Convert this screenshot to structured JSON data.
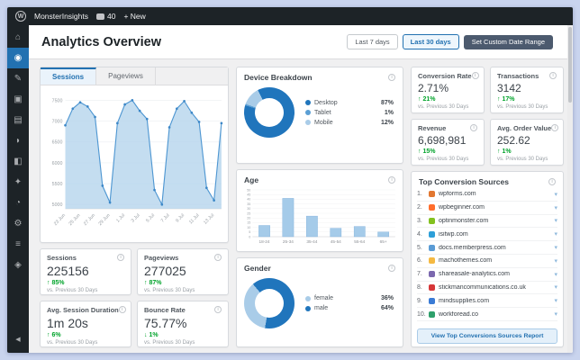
{
  "icons": {
    "wp_logo": "W",
    "info": "i",
    "chevron_down": "▾"
  },
  "palette": {
    "accent_blue": "#2271b1",
    "chart_line": "#4f97d2",
    "chart_fill": "#b5d4ec",
    "green": "#00a32a"
  },
  "admin_bar": {
    "site_name": "MonsterInsights",
    "comments_count": "40",
    "new_label": "+ New"
  },
  "sidebar": {
    "items": [
      {
        "name": "dashboard",
        "glyph": "⌂"
      },
      {
        "name": "monsterinsights",
        "glyph": "◉",
        "active": true
      },
      {
        "name": "posts",
        "glyph": "✎"
      },
      {
        "name": "media",
        "glyph": "▣"
      },
      {
        "name": "pages",
        "glyph": "▤"
      },
      {
        "name": "comments",
        "glyph": "◗"
      },
      {
        "name": "appearance",
        "glyph": "◧"
      },
      {
        "name": "plugins",
        "glyph": "✦"
      },
      {
        "name": "users",
        "glyph": "◔"
      },
      {
        "name": "tools",
        "glyph": "⚙"
      },
      {
        "name": "settings",
        "glyph": "≡"
      },
      {
        "name": "analytics",
        "glyph": "◈"
      },
      {
        "name": "collapse",
        "glyph": "◀"
      }
    ]
  },
  "header": {
    "title": "Analytics Overview",
    "last7_label": "Last 7 days",
    "last30_label": "Last 30 days",
    "custom_label": "Set Custom Date Range"
  },
  "chart_data": [
    {
      "name": "sessions_over_time",
      "type": "area",
      "tabs": [
        "Sessions",
        "Pageviews"
      ],
      "active_tab": "Sessions",
      "x": [
        "23 Jun",
        "24 Jun",
        "25 Jun",
        "26 Jun",
        "27 Jun",
        "28 Jun",
        "29 Jun",
        "30 Jun",
        "1 Jul",
        "2 Jul",
        "3 Jul",
        "4 Jul",
        "5 Jul",
        "6 Jul",
        "7 Jul",
        "8 Jul",
        "9 Jul",
        "10 Jul",
        "11 Jul",
        "12 Jul",
        "13 Jul",
        "14 Jul"
      ],
      "values": [
        6900,
        7300,
        7450,
        7350,
        7100,
        5450,
        5050,
        6950,
        7400,
        7500,
        7250,
        7050,
        5350,
        5000,
        6850,
        7300,
        7480,
        7200,
        6980,
        5400,
        5100,
        6950
      ],
      "y_ticks": [
        7500,
        7000,
        6500,
        6000,
        5500,
        5000
      ],
      "ylim": [
        4900,
        7650
      ],
      "grid": true,
      "legend_position": "none"
    },
    {
      "name": "device_breakdown",
      "type": "pie",
      "title": "Device Breakdown",
      "slices": [
        {
          "label": "Desktop",
          "value": 87,
          "color": "#2075bc"
        },
        {
          "label": "Tablet",
          "value": 1,
          "color": "#5b9fd4"
        },
        {
          "label": "Mobile",
          "value": 12,
          "color": "#a9cce8"
        }
      ],
      "rotation": 333,
      "legend_position": "right"
    },
    {
      "name": "age",
      "type": "bar",
      "title": "Age",
      "categories": [
        "18-24",
        "25-34",
        "35-44",
        "45-54",
        "55-64",
        "65+"
      ],
      "values": [
        12,
        41,
        22,
        9,
        11,
        5
      ],
      "y_ticks": [
        50,
        45,
        40,
        35,
        30,
        25,
        20,
        15,
        10,
        5,
        0
      ],
      "ylim": [
        0,
        50
      ],
      "bar_color": "#a5cbe9",
      "grid": true
    },
    {
      "name": "gender",
      "type": "pie",
      "title": "Gender",
      "slices": [
        {
          "label": "female",
          "value": 36,
          "color": "#a9cce8"
        },
        {
          "label": "male",
          "value": 64,
          "color": "#2075bc"
        }
      ],
      "rotation": 190,
      "legend_position": "right"
    }
  ],
  "metrics": {
    "vs_label": "vs. Previous 30 Days",
    "sessions": {
      "label": "Sessions",
      "value": "225156",
      "arrow": "↑",
      "change": "85%"
    },
    "pageviews": {
      "label": "Pageviews",
      "value": "277025",
      "arrow": "↑",
      "change": "87%"
    },
    "avg_session_duration": {
      "label": "Avg. Session Duration",
      "value": "1m 20s",
      "arrow": "↑",
      "change": "6%"
    },
    "bounce_rate": {
      "label": "Bounce Rate",
      "value": "75.77%",
      "arrow": "↓",
      "change": "1%"
    },
    "conversion_rate": {
      "label": "Conversion Rate",
      "value": "2.71%",
      "arrow": "↑",
      "change": "21%"
    },
    "transactions": {
      "label": "Transactions",
      "value": "3142",
      "arrow": "↑",
      "change": "17%"
    },
    "revenue": {
      "label": "Revenue",
      "value": "6,698,981",
      "arrow": "↑",
      "change": "15%"
    },
    "avg_order_value": {
      "label": "Avg. Order Value",
      "value": "252.62",
      "arrow": "↑",
      "change": "1%"
    }
  },
  "top_sources": {
    "title": "Top Conversion Sources",
    "items": [
      {
        "rank": "1.",
        "domain": "wpforms.com",
        "favicon_color": "#e27730"
      },
      {
        "rank": "2.",
        "domain": "wpbeginner.com",
        "favicon_color": "#ff6d2c"
      },
      {
        "rank": "3.",
        "domain": "optinmonster.com",
        "favicon_color": "#83c11f"
      },
      {
        "rank": "4.",
        "domain": "isitwp.com",
        "favicon_color": "#2d9fd8"
      },
      {
        "rank": "5.",
        "domain": "docs.memberpress.com",
        "favicon_color": "#5a9bd5"
      },
      {
        "rank": "6.",
        "domain": "machothemes.com",
        "favicon_color": "#f5b942"
      },
      {
        "rank": "7.",
        "domain": "shareasale-analytics.com",
        "favicon_color": "#7b68ae"
      },
      {
        "rank": "8.",
        "domain": "stickmancommunications.co.uk",
        "favicon_color": "#d63638"
      },
      {
        "rank": "9.",
        "domain": "mindsupplies.com",
        "favicon_color": "#3a7bd5"
      },
      {
        "rank": "10.",
        "domain": "workforead.co",
        "favicon_color": "#2ea06b"
      }
    ],
    "footer_button": "View Top Conversions Sources Report"
  }
}
